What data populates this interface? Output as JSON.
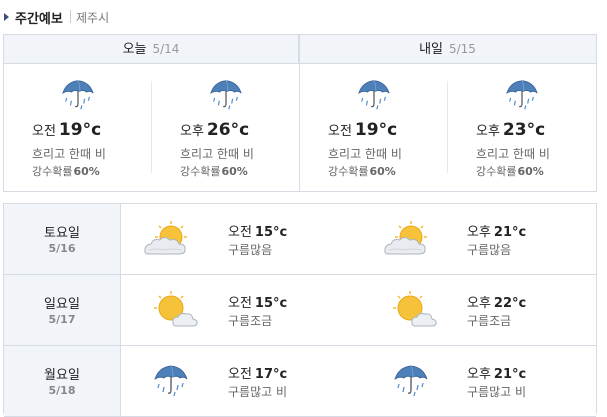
{
  "header": {
    "title": "주간예보",
    "location": "제주시"
  },
  "top": {
    "days": [
      {
        "label": "오늘",
        "date": "5/14",
        "slots": [
          {
            "period": "오전",
            "temp": "19°c",
            "desc": "흐리고 한때 비",
            "prob_label": "강수확률",
            "prob": "60%",
            "icon": "umbrella-rain-icon"
          },
          {
            "period": "오후",
            "temp": "26°c",
            "desc": "흐리고 한때 비",
            "prob_label": "강수확률",
            "prob": "60%",
            "icon": "umbrella-rain-icon"
          }
        ]
      },
      {
        "label": "내일",
        "date": "5/15",
        "slots": [
          {
            "period": "오전",
            "temp": "19°c",
            "desc": "흐리고 한때 비",
            "prob_label": "강수확률",
            "prob": "60%",
            "icon": "umbrella-rain-icon"
          },
          {
            "period": "오후",
            "temp": "23°c",
            "desc": "흐리고 한때 비",
            "prob_label": "강수확률",
            "prob": "60%",
            "icon": "umbrella-rain-icon"
          }
        ]
      }
    ]
  },
  "week": [
    {
      "day": "토요일",
      "date": "5/16",
      "am": {
        "period": "오전",
        "temp": "15°c",
        "desc": "구름많음",
        "icon": "sun-mostly-cloudy-icon"
      },
      "pm": {
        "period": "오후",
        "temp": "21°c",
        "desc": "구름많음",
        "icon": "sun-mostly-cloudy-icon"
      }
    },
    {
      "day": "일요일",
      "date": "5/17",
      "am": {
        "period": "오전",
        "temp": "15°c",
        "desc": "구름조금",
        "icon": "sun-partly-cloudy-icon"
      },
      "pm": {
        "period": "오후",
        "temp": "22°c",
        "desc": "구름조금",
        "icon": "sun-partly-cloudy-icon"
      }
    },
    {
      "day": "월요일",
      "date": "5/18",
      "am": {
        "period": "오전",
        "temp": "17°c",
        "desc": "구름많고 비",
        "icon": "umbrella-rain-icon"
      },
      "pm": {
        "period": "오후",
        "temp": "21°c",
        "desc": "구름많고 비",
        "icon": "umbrella-rain-icon"
      }
    }
  ],
  "colors": {
    "header_bg": "#f1f4f9",
    "border": "#d7dbe3",
    "umbrella": "#4d7fb8",
    "sun": "#f6c23a"
  }
}
